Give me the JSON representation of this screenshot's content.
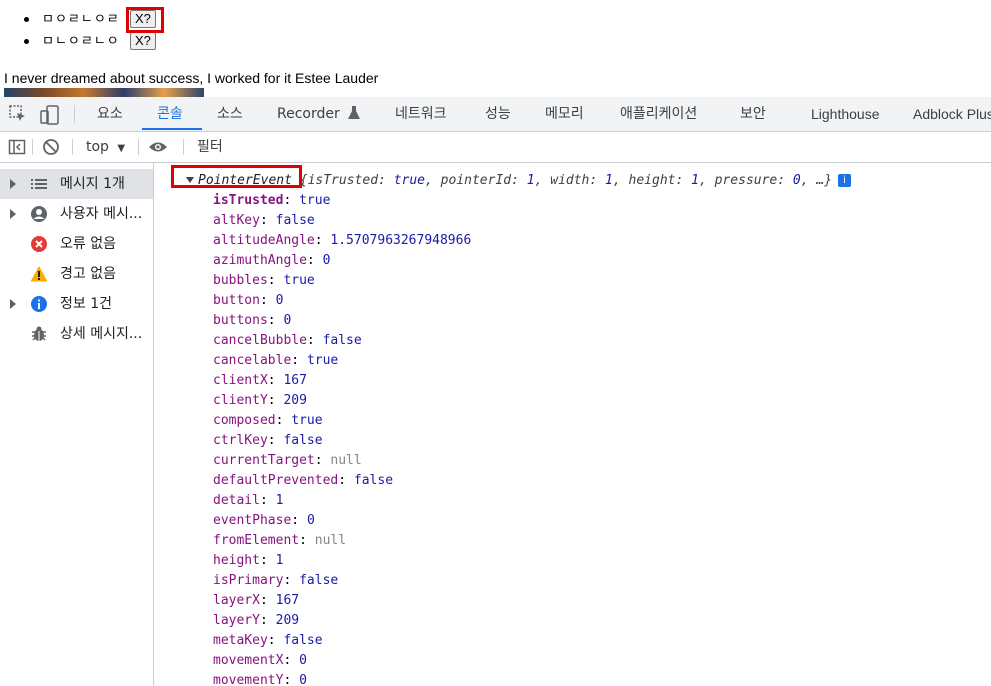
{
  "page": {
    "list_items": [
      {
        "text": "ㅁㅇㄹㄴㅇㄹ",
        "button": "X?"
      },
      {
        "text": "ㅁㄴㅇㄹㄴㅇ",
        "button": "X?"
      }
    ],
    "quote": "I never dreamed about success, I worked for it Estee Lauder"
  },
  "devtools": {
    "tabs": [
      "요소",
      "콘솔",
      "소스",
      "Recorder",
      "네트워크",
      "성능",
      "메모리",
      "애플리케이션",
      "보안",
      "Lighthouse",
      "Adblock Plus"
    ],
    "active_tab": "콘솔",
    "recorder_icon": "flask-icon",
    "toolbar": {
      "context": "top",
      "filter_placeholder": "필터"
    },
    "sidebar": [
      {
        "label": "메시지 1개",
        "icon": "list-icon",
        "expandable": true,
        "selected": true
      },
      {
        "label": "사용자 메시...",
        "icon": "user-icon",
        "expandable": true,
        "selected": false
      },
      {
        "label": "오류 없음",
        "icon": "error-icon",
        "expandable": false,
        "selected": false,
        "color": "#e53935"
      },
      {
        "label": "경고 없음",
        "icon": "warning-icon",
        "expandable": false,
        "selected": false,
        "color": "#f9ab00"
      },
      {
        "label": "정보 1건",
        "icon": "info-icon",
        "expandable": true,
        "selected": false,
        "color": "#1a73e8"
      },
      {
        "label": "상세 메시지...",
        "icon": "bug-icon",
        "expandable": false,
        "selected": false
      }
    ],
    "console": {
      "object_name": "PointerEvent",
      "preview_pairs": [
        {
          "k": "isTrusted",
          "v": "true"
        },
        {
          "k": "pointerId",
          "v": "1"
        },
        {
          "k": "width",
          "v": "1"
        },
        {
          "k": "height",
          "v": "1"
        },
        {
          "k": "pressure",
          "v": "0"
        }
      ],
      "preview_open": "{",
      "preview_close": ", …}",
      "properties": [
        {
          "k": "isTrusted",
          "v": "true",
          "type": "bool",
          "bold": true
        },
        {
          "k": "altKey",
          "v": "false",
          "type": "bool"
        },
        {
          "k": "altitudeAngle",
          "v": "1.5707963267948966",
          "type": "num"
        },
        {
          "k": "azimuthAngle",
          "v": "0",
          "type": "num"
        },
        {
          "k": "bubbles",
          "v": "true",
          "type": "bool"
        },
        {
          "k": "button",
          "v": "0",
          "type": "num"
        },
        {
          "k": "buttons",
          "v": "0",
          "type": "num"
        },
        {
          "k": "cancelBubble",
          "v": "false",
          "type": "bool"
        },
        {
          "k": "cancelable",
          "v": "true",
          "type": "bool"
        },
        {
          "k": "clientX",
          "v": "167",
          "type": "num"
        },
        {
          "k": "clientY",
          "v": "209",
          "type": "num"
        },
        {
          "k": "composed",
          "v": "true",
          "type": "bool"
        },
        {
          "k": "ctrlKey",
          "v": "false",
          "type": "bool"
        },
        {
          "k": "currentTarget",
          "v": "null",
          "type": "null"
        },
        {
          "k": "defaultPrevented",
          "v": "false",
          "type": "bool"
        },
        {
          "k": "detail",
          "v": "1",
          "type": "num"
        },
        {
          "k": "eventPhase",
          "v": "0",
          "type": "num"
        },
        {
          "k": "fromElement",
          "v": "null",
          "type": "null"
        },
        {
          "k": "height",
          "v": "1",
          "type": "num"
        },
        {
          "k": "isPrimary",
          "v": "false",
          "type": "bool"
        },
        {
          "k": "layerX",
          "v": "167",
          "type": "num"
        },
        {
          "k": "layerY",
          "v": "209",
          "type": "num"
        },
        {
          "k": "metaKey",
          "v": "false",
          "type": "bool"
        },
        {
          "k": "movementX",
          "v": "0",
          "type": "num"
        },
        {
          "k": "movementY",
          "v": "0",
          "type": "num"
        }
      ]
    }
  }
}
